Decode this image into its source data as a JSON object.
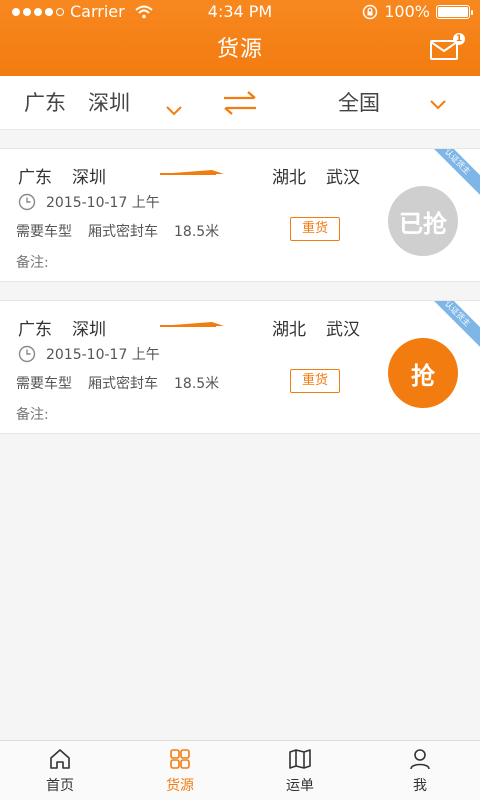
{
  "status": {
    "carrier": "Carrier",
    "time": "4:34 PM",
    "battery": "100%"
  },
  "nav": {
    "title": "货源",
    "mail_badge": "1"
  },
  "filter": {
    "origin_province": "广东",
    "origin_city": "深圳",
    "destination": "全国"
  },
  "cards": [
    {
      "from_province": "广东",
      "from_city": "深圳",
      "to_province": "湖北",
      "to_city": "武汉",
      "date": "2015-10-17 上午",
      "vehicle_label": "需要车型",
      "vehicle_type": "厢式密封车",
      "length": "18.5米",
      "tag": "重货",
      "note": "备注:",
      "action": "已抢",
      "ribbon": "认证货主"
    },
    {
      "from_province": "广东",
      "from_city": "深圳",
      "to_province": "湖北",
      "to_city": "武汉",
      "date": "2015-10-17 上午",
      "vehicle_label": "需要车型",
      "vehicle_type": "厢式密封车",
      "length": "18.5米",
      "tag": "重货",
      "note": "备注:",
      "action": "抢",
      "ribbon": "认证货主"
    }
  ],
  "tabs": [
    {
      "label": "首页",
      "icon": "home-icon"
    },
    {
      "label": "货源",
      "icon": "grid-icon"
    },
    {
      "label": "运单",
      "icon": "map-icon"
    },
    {
      "label": "我",
      "icon": "user-icon"
    }
  ],
  "colors": {
    "accent": "#f37c10",
    "ribbon": "#7fb6e8",
    "grabbed": "#cfcfcf"
  }
}
